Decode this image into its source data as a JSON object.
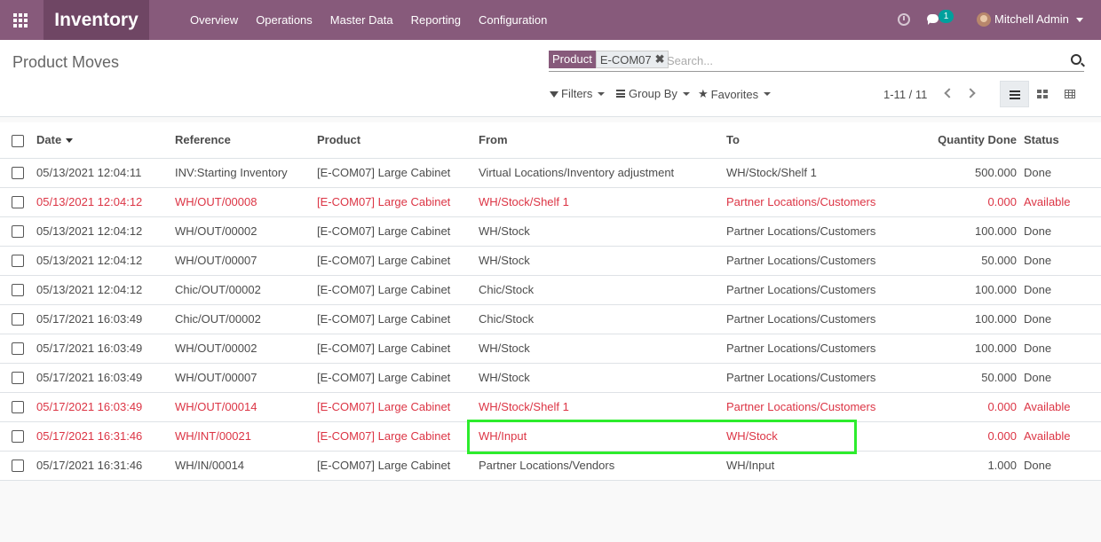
{
  "topbar": {
    "app_title": "Inventory",
    "menu": [
      "Overview",
      "Operations",
      "Master Data",
      "Reporting",
      "Configuration"
    ],
    "chat_badge": "1",
    "user_name": "Mitchell Admin"
  },
  "control": {
    "page_title": "Product Moves",
    "facet_label": "Product",
    "facet_value": "E-COM07",
    "search_placeholder": "Search...",
    "filters_label": "Filters",
    "groupby_label": "Group By",
    "favorites_label": "Favorites",
    "pager": "1-11 / 11"
  },
  "table": {
    "headers": [
      "Date",
      "Reference",
      "Product",
      "From",
      "To",
      "Quantity Done",
      "Status"
    ],
    "rows": [
      {
        "date": "05/13/2021 12:04:11",
        "reference": "INV:Starting Inventory",
        "product": "[E-COM07] Large Cabinet",
        "from": "Virtual Locations/Inventory adjustment",
        "to": "WH/Stock/Shelf 1",
        "qty": "500.000",
        "status": "Done",
        "red": false
      },
      {
        "date": "05/13/2021 12:04:12",
        "reference": "WH/OUT/00008",
        "product": "[E-COM07] Large Cabinet",
        "from": "WH/Stock/Shelf 1",
        "to": "Partner Locations/Customers",
        "qty": "0.000",
        "status": "Available",
        "red": true
      },
      {
        "date": "05/13/2021 12:04:12",
        "reference": "WH/OUT/00002",
        "product": "[E-COM07] Large Cabinet",
        "from": "WH/Stock",
        "to": "Partner Locations/Customers",
        "qty": "100.000",
        "status": "Done",
        "red": false
      },
      {
        "date": "05/13/2021 12:04:12",
        "reference": "WH/OUT/00007",
        "product": "[E-COM07] Large Cabinet",
        "from": "WH/Stock",
        "to": "Partner Locations/Customers",
        "qty": "50.000",
        "status": "Done",
        "red": false
      },
      {
        "date": "05/13/2021 12:04:12",
        "reference": "Chic/OUT/00002",
        "product": "[E-COM07] Large Cabinet",
        "from": "Chic/Stock",
        "to": "Partner Locations/Customers",
        "qty": "100.000",
        "status": "Done",
        "red": false
      },
      {
        "date": "05/17/2021 16:03:49",
        "reference": "Chic/OUT/00002",
        "product": "[E-COM07] Large Cabinet",
        "from": "Chic/Stock",
        "to": "Partner Locations/Customers",
        "qty": "100.000",
        "status": "Done",
        "red": false
      },
      {
        "date": "05/17/2021 16:03:49",
        "reference": "WH/OUT/00002",
        "product": "[E-COM07] Large Cabinet",
        "from": "WH/Stock",
        "to": "Partner Locations/Customers",
        "qty": "100.000",
        "status": "Done",
        "red": false
      },
      {
        "date": "05/17/2021 16:03:49",
        "reference": "WH/OUT/00007",
        "product": "[E-COM07] Large Cabinet",
        "from": "WH/Stock",
        "to": "Partner Locations/Customers",
        "qty": "50.000",
        "status": "Done",
        "red": false
      },
      {
        "date": "05/17/2021 16:03:49",
        "reference": "WH/OUT/00014",
        "product": "[E-COM07] Large Cabinet",
        "from": "WH/Stock/Shelf 1",
        "to": "Partner Locations/Customers",
        "qty": "0.000",
        "status": "Available",
        "red": true
      },
      {
        "date": "05/17/2021 16:31:46",
        "reference": "WH/INT/00021",
        "product": "[E-COM07] Large Cabinet",
        "from": "WH/Input",
        "to": "WH/Stock",
        "qty": "0.000",
        "status": "Available",
        "red": true
      },
      {
        "date": "05/17/2021 16:31:46",
        "reference": "WH/IN/00014",
        "product": "[E-COM07] Large Cabinet",
        "from": "Partner Locations/Vendors",
        "to": "WH/Input",
        "qty": "1.000",
        "status": "Done",
        "red": false
      }
    ]
  },
  "colors": {
    "brand": "#875a7b",
    "brand_dark": "#6f4664",
    "alert_red": "#dc3545",
    "highlight_green": "#2dec2d",
    "badge_teal": "#00a09d"
  }
}
